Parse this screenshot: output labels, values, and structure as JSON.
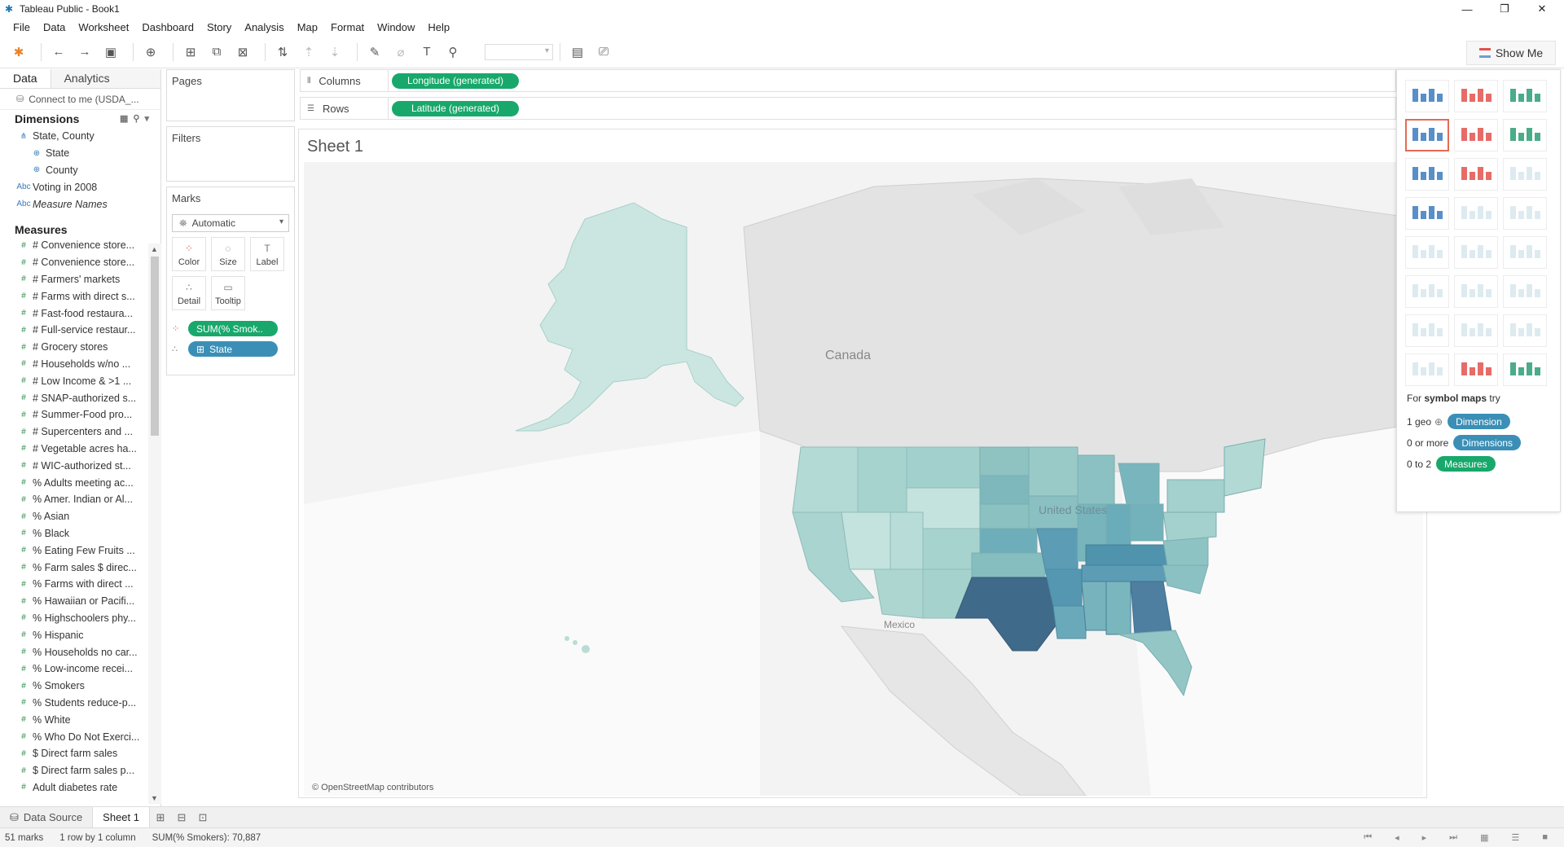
{
  "window": {
    "title": "Tableau Public - Book1"
  },
  "menu": [
    "File",
    "Data",
    "Worksheet",
    "Dashboard",
    "Story",
    "Analysis",
    "Map",
    "Format",
    "Window",
    "Help"
  ],
  "toolbar": {
    "show_me_label": "Show Me"
  },
  "data_pane": {
    "tabs": [
      "Data",
      "Analytics"
    ],
    "connection": "Connect to me (USDA_...",
    "dimensions_header": "Dimensions",
    "dimensions": [
      {
        "label": "State, County",
        "icon": "hierarchy-icon",
        "level": 1
      },
      {
        "label": "State",
        "icon": "globe-icon",
        "level": 2
      },
      {
        "label": "County",
        "icon": "globe-icon",
        "level": 2
      },
      {
        "label": "Voting in 2008",
        "icon": "abc-icon",
        "level": 1
      },
      {
        "label": "Measure Names",
        "icon": "abc-icon",
        "level": 1
      }
    ],
    "measures_header": "Measures",
    "measures": [
      "# Convenience store...",
      "# Convenience store...",
      "# Farmers' markets",
      "# Farms with direct s...",
      "# Fast-food restaura...",
      "# Full-service restaur...",
      "# Grocery stores",
      "# Households w/no ...",
      "# Low Income & >1 ...",
      "# SNAP-authorized s...",
      "# Summer-Food pro...",
      "# Supercenters and ...",
      "# Vegetable acres ha...",
      "# WIC-authorized st...",
      "% Adults meeting ac...",
      "% Amer. Indian or Al...",
      "% Asian",
      "% Black",
      "% Eating Few Fruits ...",
      "% Farm sales $ direc...",
      "% Farms with direct ...",
      "% Hawaiian or Pacifi...",
      "% Highschoolers phy...",
      "% Hispanic",
      "% Households no car...",
      "% Low-income recei...",
      "% Smokers",
      "% Students reduce-p...",
      "% White",
      "% Who Do Not Exerci...",
      "$ Direct farm sales",
      "$ Direct farm sales p...",
      "Adult diabetes rate"
    ]
  },
  "cards": {
    "pages": "Pages",
    "filters": "Filters",
    "marks": "Marks",
    "mark_type": "Automatic",
    "mark_buttons": [
      {
        "label": "Color",
        "icon": "color-icon"
      },
      {
        "label": "Size",
        "icon": "size-icon"
      },
      {
        "label": "Label",
        "icon": "label-icon"
      },
      {
        "label": "Detail",
        "icon": "detail-icon"
      },
      {
        "label": "Tooltip",
        "icon": "tooltip-icon"
      }
    ],
    "mark_pills": [
      {
        "label": "SUM(% Smok..",
        "color": "#18a86b"
      },
      {
        "label": "State",
        "color": "#3b8fb6"
      }
    ]
  },
  "shelves": {
    "columns_label": "Columns",
    "columns_pill": "Longitude (generated)",
    "rows_label": "Rows",
    "rows_pill": "Latitude (generated)"
  },
  "sheet": {
    "title": "Sheet 1",
    "map_labels": [
      "Canada",
      "United States",
      "Mexico"
    ],
    "credit": "© OpenStreetMap contributors"
  },
  "show_me": {
    "hint_prefix": "For",
    "hint_bold": "symbol maps",
    "hint_suffix": "try",
    "rows": [
      {
        "label": "1 geo",
        "pill": "Dimension",
        "color": "#3b8fb6"
      },
      {
        "label": "0 or more",
        "pill": "Dimensions",
        "color": "#3b8fb6"
      },
      {
        "label": "0 to 2",
        "pill": "Measures",
        "color": "#18a86b"
      }
    ]
  },
  "tabs": {
    "data_source": "Data Source",
    "sheet": "Sheet 1"
  },
  "status": {
    "marks": "51 marks",
    "dims": "1 row by 1 column",
    "sum": "SUM(% Smokers): 70,887"
  },
  "colors": {
    "green_pill": "#18a86b",
    "blue_pill": "#3b8fb6",
    "map_light": "#c6e3df",
    "map_dark": "#3f6a8a"
  }
}
